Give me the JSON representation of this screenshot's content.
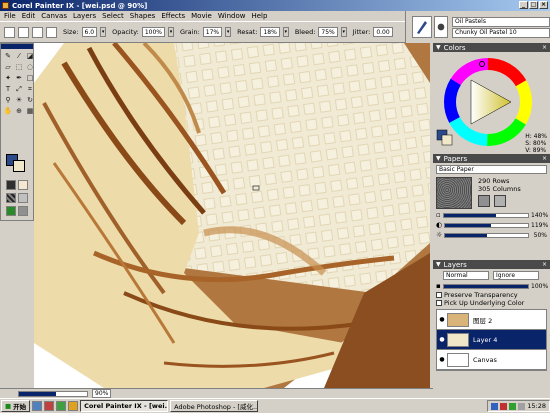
{
  "window": {
    "title": "Corel Painter IX - [wei.psd @ 90%]",
    "controls": [
      "_",
      "□",
      "×"
    ]
  },
  "menu": [
    {
      "label": "File"
    },
    {
      "label": "Edit"
    },
    {
      "label": "Canvas"
    },
    {
      "label": "Layers"
    },
    {
      "label": "Select"
    },
    {
      "label": "Shapes"
    },
    {
      "label": "Effects"
    },
    {
      "label": "Movie"
    },
    {
      "label": "Window"
    },
    {
      "label": "Help"
    }
  ],
  "property_bar": {
    "size_label": "Size:",
    "size_value": "6.0",
    "opacity_label": "Opacity:",
    "opacity_value": "100%",
    "grain_label": "Grain:",
    "grain_value": "17%",
    "resat_label": "Resat:",
    "resat_value": "18%",
    "bleed_label": "Bleed:",
    "bleed_value": "75%",
    "jitter_label": "Jitter:",
    "jitter_value": "0.00"
  },
  "brush_selector": {
    "category": "Oil Pastels",
    "variant": "Chunky Oil Pastel 10"
  },
  "colors_panel": {
    "title": "Colors",
    "h": "H: 48%",
    "s": "S: 80%",
    "v": "V: 89%",
    "main_color": "#2c4a8a",
    "additional_color": "#f0e8c8"
  },
  "papers_panel": {
    "title": "Papers",
    "paper_name": "Basic Paper",
    "rows": "290 Rows",
    "columns": "305 Columns",
    "scale": "140%",
    "contrast": "119%",
    "brightness": "50%",
    "scale_level": 0.62,
    "contrast_level": 0.55,
    "brightness_level": 0.5
  },
  "layers_panel": {
    "title": "Layers",
    "composite_method": "Normal",
    "depth_method": "Ignore",
    "opacity": "100%",
    "opacity_level": 1.0,
    "preserve_transparency": "Preserve Transparency",
    "pick_up_underlying": "Pick Up Underlying Color",
    "layers": [
      {
        "name": "图层 2",
        "active": false
      },
      {
        "name": "Layer 4",
        "active": true
      },
      {
        "name": "Canvas",
        "active": false
      }
    ]
  },
  "status": {
    "zoom": "90%",
    "zoom_level": 0.55
  },
  "taskbar": {
    "start": "开始",
    "tasks": [
      {
        "label": "Corel Painter IX - [wei...",
        "active": true
      },
      {
        "label": "Adobe Photoshop - [威化...",
        "active": false
      }
    ],
    "clock": "15:28"
  }
}
